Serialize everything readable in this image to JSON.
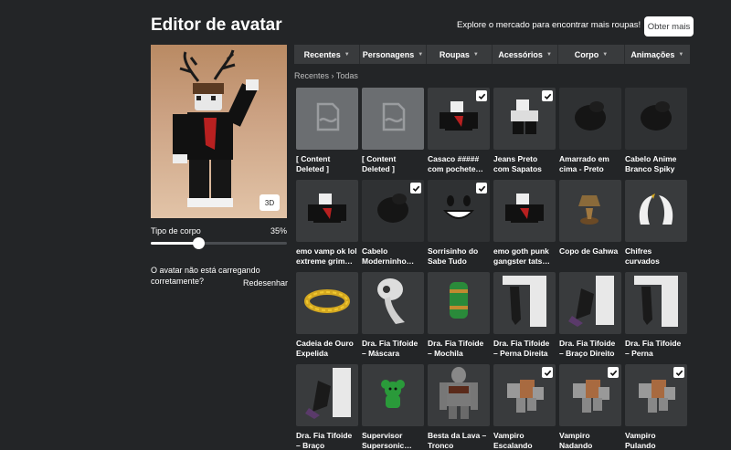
{
  "header": {
    "title": "Editor de avatar",
    "market_text": "Explore o mercado para encontrar mais roupas!",
    "get_more_label": "Obter mais"
  },
  "preview": {
    "btn_3d_label": "3D"
  },
  "body_type": {
    "label": "Tipo de corpo",
    "value": "35%",
    "fraction": 0.35
  },
  "loading_msg": "O avatar não está carregando corretamente?",
  "redraw_label": "Redesenhar",
  "tabs": [
    {
      "label": "Recentes"
    },
    {
      "label": "Personagens"
    },
    {
      "label": "Roupas"
    },
    {
      "label": "Acessórios"
    },
    {
      "label": "Corpo"
    },
    {
      "label": "Animações"
    }
  ],
  "breadcrumb": {
    "parent": "Recentes",
    "separator": "›",
    "current": "Todas"
  },
  "items": [
    {
      "name": "[ Content Deleted ]",
      "icon": "deleted-icon",
      "checked": false
    },
    {
      "name": "[ Content Deleted ]",
      "icon": "deleted-icon",
      "checked": false
    },
    {
      "name": "Casaco ##### com pochete…",
      "icon": "shirt-icon",
      "checked": true
    },
    {
      "name": "Jeans Preto com Sapatos Brancos",
      "icon": "pants-icon",
      "checked": true
    },
    {
      "name": "Amarrado em cima - Preto",
      "icon": "hair-icon",
      "checked": false
    },
    {
      "name": "Cabelo Anime Branco Spiky",
      "icon": "hair-icon",
      "checked": false
    },
    {
      "name": "emo vamp ok lol extreme grim…",
      "icon": "shirt-icon",
      "checked": false
    },
    {
      "name": "Cabelo Moderninho…",
      "icon": "hair-icon",
      "checked": true
    },
    {
      "name": "Sorrisinho do Sabe Tudo",
      "icon": "face-icon",
      "checked": true
    },
    {
      "name": "emo goth punk gangster tats…",
      "icon": "shirt-icon",
      "checked": false
    },
    {
      "name": "Copo de Gahwa",
      "icon": "cup-icon",
      "checked": false
    },
    {
      "name": "Chifres curvados dourados e…",
      "icon": "horns-icon",
      "checked": false
    },
    {
      "name": "Cadeia de Ouro Expelida",
      "icon": "chain-icon",
      "checked": false
    },
    {
      "name": "Dra. Fia Tifoide – Máscara",
      "icon": "mask-icon",
      "checked": false
    },
    {
      "name": "Dra. Fia Tifoide – Mochila",
      "icon": "backpack-icon",
      "checked": false
    },
    {
      "name": "Dra. Fia Tifoide – Perna Direita",
      "icon": "leg-icon",
      "checked": false
    },
    {
      "name": "Dra. Fia Tifoide – Braço Direito",
      "icon": "arm-icon",
      "checked": false
    },
    {
      "name": "Dra. Fia Tifoide – Perna Esquerda",
      "icon": "leg-icon",
      "checked": false
    },
    {
      "name": "Dra. Fia Tifoide – Braço Esquerdo",
      "icon": "arm-icon",
      "checked": false
    },
    {
      "name": "Supervisor Supersonic…",
      "icon": "bear-icon",
      "checked": false
    },
    {
      "name": "Besta da Lava – Tronco",
      "icon": "torso-icon",
      "checked": false
    },
    {
      "name": "Vampiro Escalando",
      "icon": "animation-icon",
      "checked": true
    },
    {
      "name": "Vampiro Nadando",
      "icon": "animation-icon",
      "checked": true
    },
    {
      "name": "Vampiro Pulando",
      "icon": "animation-icon",
      "checked": true
    }
  ]
}
